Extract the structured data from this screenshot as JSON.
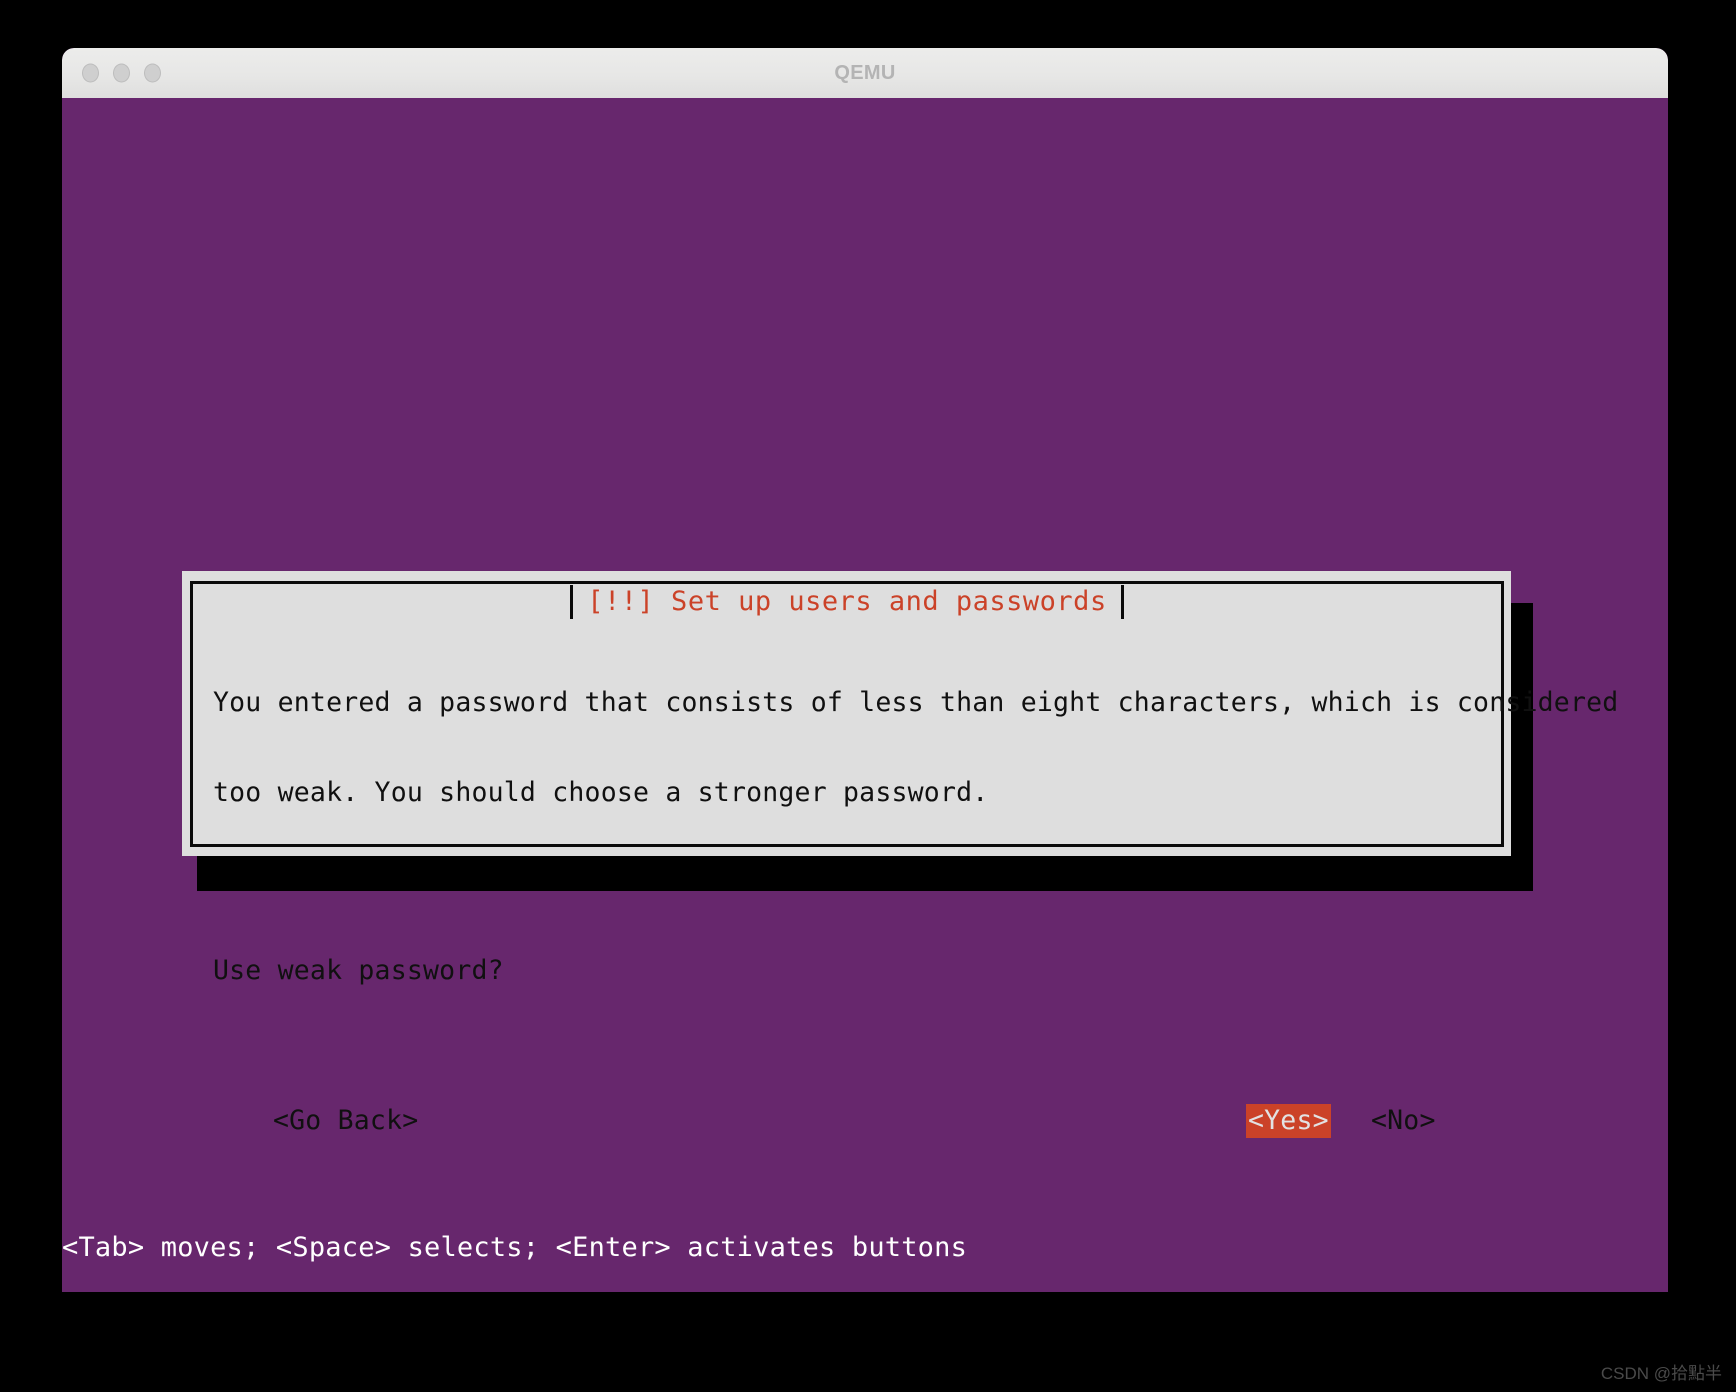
{
  "window": {
    "title": "QEMU",
    "traffic_lights": [
      "close",
      "minimize",
      "maximize"
    ]
  },
  "console": {
    "background_color": "#67276d",
    "status_line": "<Tab> moves; <Space> selects; <Enter> activates buttons"
  },
  "dialog": {
    "title": "[!!] Set up users and passwords",
    "title_color": "#cb4228",
    "background_color": "#dedede",
    "border_color": "#0a0a0a",
    "body": {
      "paragraph1_line1": "You entered a password that consists of less than eight characters, which is considered",
      "paragraph1_line2": "too weak. You should choose a stronger password.",
      "paragraph2": "Use weak password?"
    },
    "buttons": [
      {
        "label": "<Go Back>",
        "selected": false
      },
      {
        "label": "<Yes>",
        "selected": true
      },
      {
        "label": "<No>",
        "selected": false
      }
    ],
    "selected_button_bg": "#cb4228",
    "selected_button_fg": "#e2e2e2"
  },
  "watermark": {
    "text": "CSDN @拾點半"
  }
}
